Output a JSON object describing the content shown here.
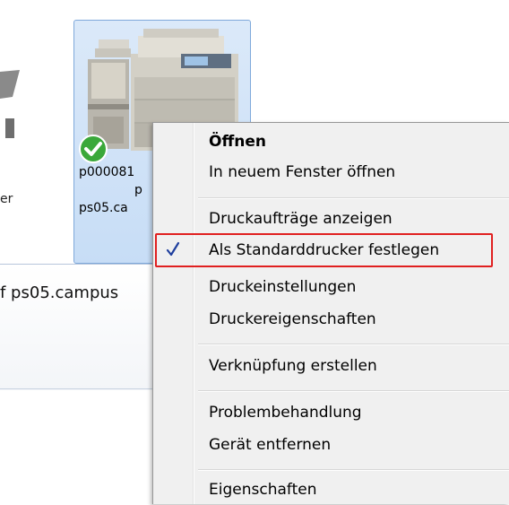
{
  "background_window": {
    "left_partial_label": "er",
    "selected_item": {
      "name_line1": "p000081",
      "name_line2": "p",
      "name_line3": "ps05.ca"
    },
    "details_text": "f ps05.campus"
  },
  "context_menu": {
    "items": [
      {
        "label": "Öffnen",
        "bold": true
      },
      {
        "label": "In neuem Fenster öffnen"
      },
      {
        "label": "Druckaufträge anzeigen"
      },
      {
        "label": "Als Standarddrucker festlegen",
        "checked": true,
        "highlighted": true
      },
      {
        "label": "Druckeinstellungen"
      },
      {
        "label": "Druckereigenschaften"
      },
      {
        "label": "Verknüpfung erstellen"
      },
      {
        "label": "Problembehandlung"
      },
      {
        "label": "Gerät entfernen"
      },
      {
        "label": "Eigenschaften"
      }
    ]
  },
  "colors": {
    "highlight_border": "#e02020",
    "checkmark": "#1f3f9e",
    "selection_fill": "#cfe2f8",
    "default_badge": "#3aa83a"
  }
}
